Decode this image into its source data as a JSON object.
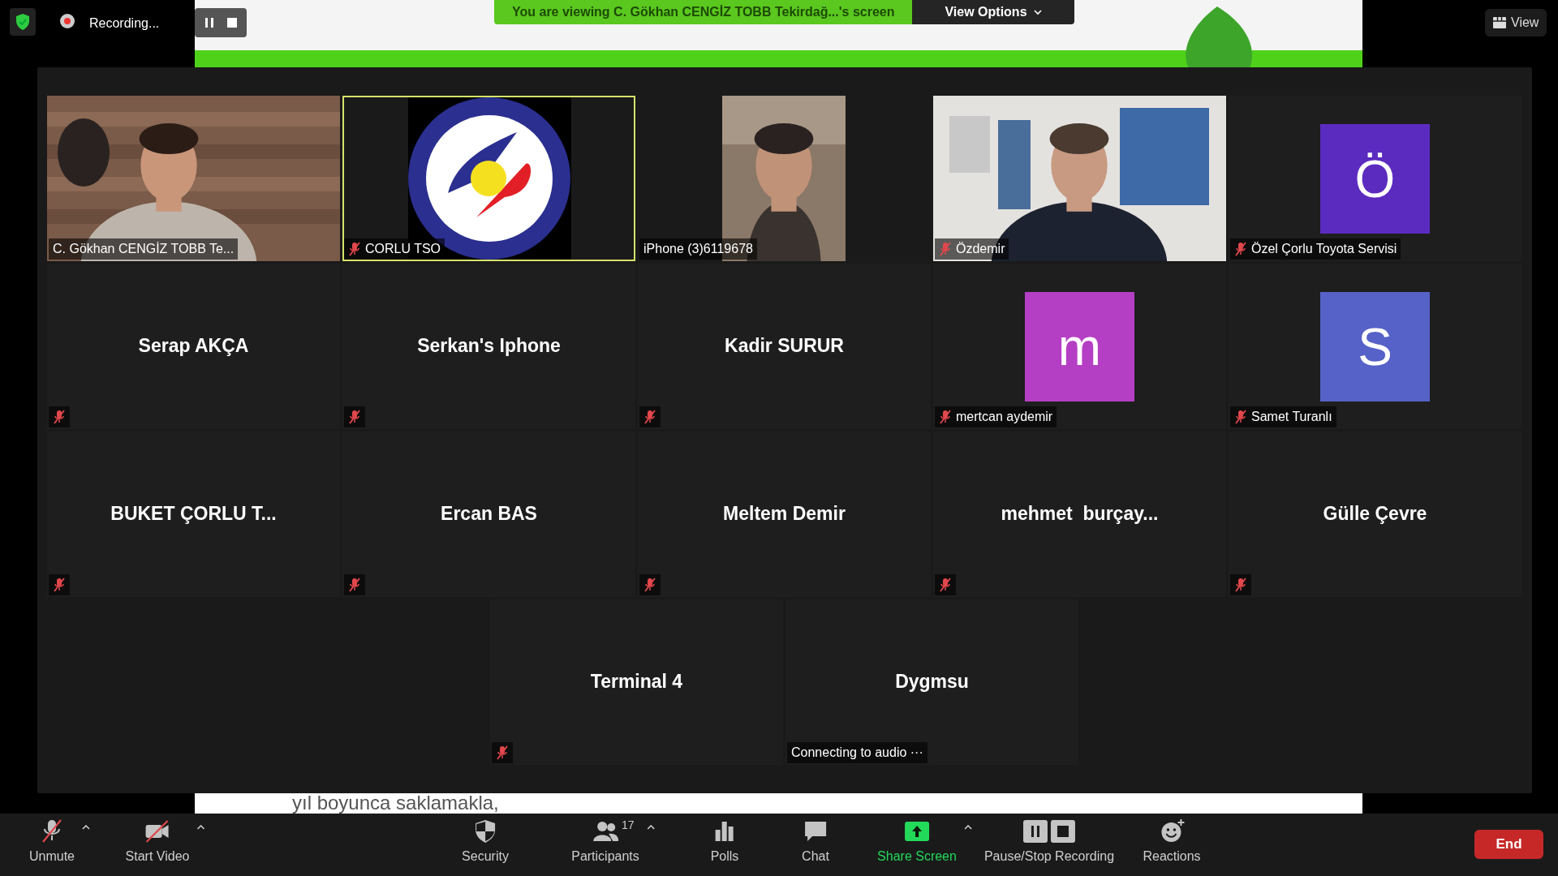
{
  "top_bar": {
    "recording": "Recording...",
    "banner": "You are viewing C. Gökhan CENGİZ TOBB Tekirdağ...'s screen",
    "view_options": "View Options",
    "view": "View"
  },
  "shared_screen": {
    "caption": "yıl boyunca saklamakla,"
  },
  "tiles": [
    {
      "name": "C. Gökhan CENGİZ TOBB Te...",
      "kind": "video-wide",
      "muted": false,
      "selected": false
    },
    {
      "name": "CORLU TSO",
      "kind": "logo",
      "muted": true,
      "selected": true
    },
    {
      "name": "iPhone (3)6119678",
      "kind": "video-narrow",
      "muted": false,
      "selected": false
    },
    {
      "name": "Özdemir",
      "kind": "video-wide",
      "muted": true,
      "selected": false
    },
    {
      "name": "Özel Çorlu Toyota Servisi",
      "kind": "avatar",
      "initial": "Ö",
      "color": "#5b2bbf",
      "muted": true,
      "selected": false
    },
    {
      "name": "Serap AKÇA",
      "kind": "name",
      "muted": true,
      "selected": false
    },
    {
      "name": "Serkan's Iphone",
      "kind": "name",
      "muted": true,
      "selected": false
    },
    {
      "name": "Kadir SURUR",
      "kind": "name",
      "muted": true,
      "selected": false
    },
    {
      "name": "mertcan aydemir",
      "kind": "avatar",
      "initial": "m",
      "color": "#b53fc4",
      "muted": true,
      "selected": false
    },
    {
      "name": "Samet Turanlı",
      "kind": "avatar",
      "initial": "S",
      "color": "#5662c8",
      "muted": true,
      "selected": false
    },
    {
      "name": "BUKET ÇORLU T...",
      "kind": "name",
      "muted": true,
      "selected": false
    },
    {
      "name": "Ercan BAS",
      "kind": "name",
      "muted": true,
      "selected": false
    },
    {
      "name": "Meltem Demir",
      "kind": "name",
      "muted": true,
      "selected": false
    },
    {
      "name": "mehmet  burçay...",
      "kind": "name",
      "muted": true,
      "selected": false
    },
    {
      "name": "Gülle Çevre",
      "kind": "name",
      "muted": true,
      "selected": false
    },
    {
      "name": "Terminal 4",
      "kind": "name",
      "muted": true,
      "selected": false
    },
    {
      "name": "Dygmsu",
      "kind": "name",
      "muted": false,
      "selected": false,
      "status": "Connecting to audio ···"
    }
  ],
  "toolbar": {
    "items": [
      {
        "label": "Unmute",
        "kind": "mic-off",
        "caret": true
      },
      {
        "label": "Start Video",
        "kind": "video-off",
        "caret": true
      },
      {
        "label": "Security",
        "kind": "shield",
        "caret": false
      },
      {
        "label": "Participants",
        "kind": "people",
        "count": "17",
        "caret": true
      },
      {
        "label": "Polls",
        "kind": "polls",
        "caret": false
      },
      {
        "label": "Chat",
        "kind": "chat",
        "caret": false
      },
      {
        "label": "Share Screen",
        "kind": "share",
        "caret": true
      },
      {
        "label": "Pause/Stop Recording",
        "kind": "recording",
        "caret": false
      },
      {
        "label": "Reactions",
        "kind": "reactions",
        "caret": false
      }
    ],
    "end": "End"
  }
}
